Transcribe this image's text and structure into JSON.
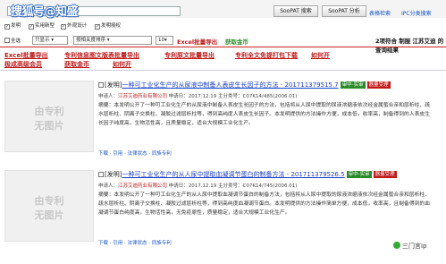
{
  "watermark": "搜狐号@知盛",
  "search": {
    "value": ""
  },
  "buttons": {
    "search": "SooPAT 搜索",
    "analysis": "SooPAT 分析"
  },
  "top_links": [
    "表格检索",
    "IPC分类搜索"
  ],
  "filters": [
    {
      "label": "发明",
      "checked": true
    },
    {
      "label": "实用新型",
      "checked": true
    },
    {
      "label": "外观设计",
      "checked": true
    },
    {
      "label": "发明授权",
      "checked": true
    }
  ],
  "toolbar": {
    "select_all": "全选",
    "select_all_checked": false,
    "export_label": "只显示",
    "sort_value": "按相关度排序",
    "page_size": "10",
    "excel_export": "Excel批量导出",
    "earn_coins": "获取金币",
    "hits_text": "2项符合 制服 江苏艾迪 的查询结果"
  },
  "red_links": [
    "Excel批量导出",
    "专利信息图文版表批量导出",
    "专利原文批量导出",
    "专利全文免提打包下载",
    "如何开",
    "极成高级会员",
    "获取金币",
    "如何开"
  ],
  "results": [
    {
      "prefix": "[发明]",
      "title": "一种可工业化生产的从尿液中制备人表皮生长因子的方法 - 201711379515.7",
      "badges": [
        "审中-实审",
        "器量受理"
      ],
      "applicant_label": "申请人：",
      "applicant": "江苏艾迪药业有限公司",
      "date": "申请日：2017.12.19",
      "ipc": "主分类号：C07K14/485(2006.01)",
      "abstract": "摘要：本发明公开了一种可工业化生产的从尿液中制备人表皮生长因子的方法，包括将从人尿中提取的尿液浓缩液依次经金属螯合亲和层析柱、疏水层析柱、阴离子交换柱、凝胶过滤层析柱等，得到高纯度人表皮生长因子。本发明提供的方法操作方便，成本低，收率高，制备得到的人表皮生长因子纯度高，生物活性高，且质量稳定，适合大规模工业化生产。",
      "thumb": "由专利\n无图片",
      "tools": "下载 · 引用 · 法律状态 · 同族专利"
    },
    {
      "prefix": "[发明]",
      "title": "一种可工业化生产的从人尿中提取血凝调节蛋白的制备方法 - 201711379526.5",
      "badges": [
        "审中-实审",
        "器量受理"
      ],
      "applicant_label": "申请人：",
      "applicant": "江苏艾迪药业有限公司",
      "date": "申请日：2017.12.19",
      "ipc": "主分类号：C07K14/745(2006.01)",
      "abstract": "摘要：本发明公开了一种可工业化生产的从人尿中提取血凝调节蛋白的制备方法，包括将从人尿中提取的尿液浓缩液依次经金属螯合亲和层析柱、疏水层析柱、阴离子交换柱、凝胶过滤层析柱等，得到高纯度血凝调节蛋白。本发明提供的方法操作简单方便，成本低，收率高，且制备得到的血凝调节蛋白纯度高，生物活性高，无免疫原性，质量稳定，适合大规模工业化生产。",
      "thumb": "由专利\n无图片",
      "tools": "下载 · 引用 · 法律状态 · 同族专利"
    }
  ],
  "footer_logo": "三门言ip"
}
